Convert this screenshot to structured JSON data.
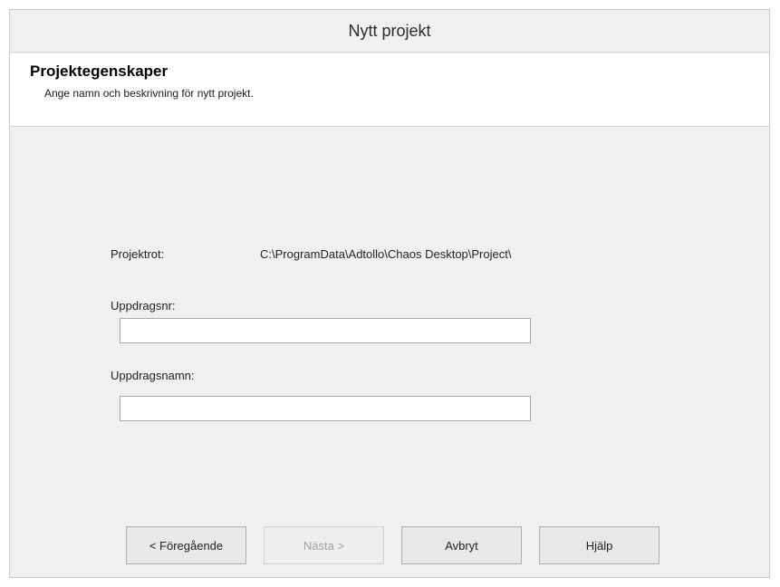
{
  "window": {
    "title": "Nytt projekt"
  },
  "header": {
    "title": "Projektegenskaper",
    "subtitle": "Ange namn och beskrivning för nytt projekt."
  },
  "form": {
    "root_label": "Projektrot:",
    "root_value": "C:\\ProgramData\\Adtollo\\Chaos Desktop\\Project\\",
    "assignment_number_label": "Uppdragsnr:",
    "assignment_number_value": "",
    "assignment_name_label": "Uppdragsnamn:",
    "assignment_name_value": ""
  },
  "buttons": {
    "previous": "< Föregående",
    "next": "Nästa >",
    "cancel": "Avbryt",
    "help": "Hjälp"
  }
}
